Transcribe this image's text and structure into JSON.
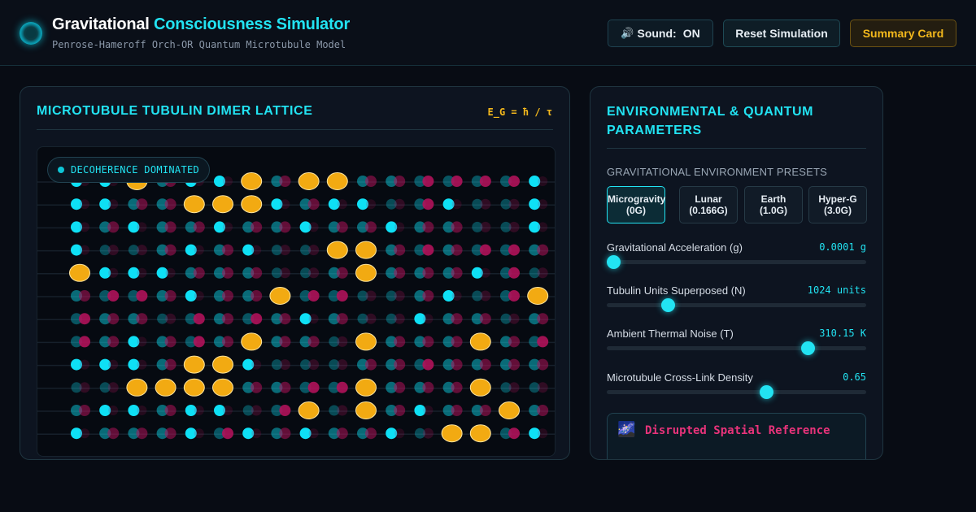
{
  "header": {
    "title_part1": "Gravitational",
    "title_part2": "Consciousness Simulator",
    "subtitle": "Penrose-Hameroff Orch-OR Quantum Microtubule Model",
    "sound_icon": "speaker-icon",
    "sound_label": "Sound:",
    "sound_value": "ON",
    "reset_label": "Reset Simulation",
    "summary_label": "Summary Card"
  },
  "lattice_panel": {
    "title": "MICROTUBULE TUBULIN DIMER LATTICE",
    "formula": "E_G = ħ / τ",
    "state_badge": "DECOHERENCE DOMINATED",
    "colors": {
      "coherent": "#0ee0f5",
      "decohered": "#b0125a",
      "superposed": "#f2aa12"
    },
    "grid": [
      "ccDhccDhDDhhddddchcchhDD",
      "cchhDDDchccsdcsscchhscch",
      "chchhchhchhchhsschhschch",
      "csshchcssDDhdhddhDhcchdh",
      "DccchhhsshDhhhcdsDddcdch",
      "hddhchhDddsshcsdDhscschc",
      "dhhsdhdhchsschhshhhccDDD",
      "dhchdhDhhsDhhhDhdddhdDdd",
      "ccchDDcssshhdhhhhsdhsDhD",
      "ssDDDDhhddDhhhDsshhhscDc",
      "hcchccsdDsDhchhDhhhcchDh",
      "chhhcdchchhcsDDdchdcdhhh"
    ]
  },
  "params_panel": {
    "title": "ENVIRONMENTAL & QUANTUM PARAMETERS",
    "presets_label": "GRAVITATIONAL ENVIRONMENT PRESETS",
    "presets": [
      {
        "name": "Microgravity",
        "value": "(0G)",
        "active": true
      },
      {
        "name": "Lunar",
        "value": "(0.166G)",
        "active": false
      },
      {
        "name": "Earth",
        "value": "(1.0G)",
        "active": false
      },
      {
        "name": "Hyper-G",
        "value": "(3.0G)",
        "active": false
      }
    ],
    "sliders": [
      {
        "label": "Gravitational Acceleration (g)",
        "value": "0.0001 g",
        "fraction": 0.0
      },
      {
        "label": "Tubulin Units Superposed (N)",
        "value": "1024 units",
        "fraction": 0.22
      },
      {
        "label": "Ambient Thermal Noise (T)",
        "value": "310.15 K",
        "fraction": 0.79
      },
      {
        "label": "Microtubule Cross-Link Density",
        "value": "0.65",
        "fraction": 0.62
      }
    ],
    "alert_icon": "galaxy-icon",
    "alert_text": "Disrupted Spatial Reference"
  }
}
